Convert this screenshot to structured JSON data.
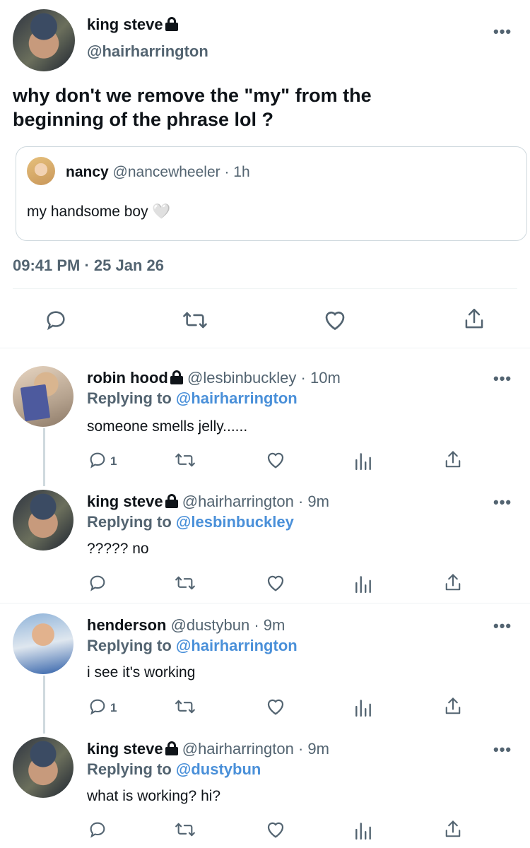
{
  "main_tweet": {
    "author_name": "king steve",
    "author_handle": "@hairharrington",
    "text_line1": "why don't we remove the \"my\" from the",
    "text_line2": "beginning of the phrase lol ?",
    "more": "•••",
    "timestamp": "09:41 PM · 25 Jan 26",
    "quoted": {
      "author_name": "nancy",
      "author_handle": "@nancewheeler",
      "time": "· 1h",
      "text": "my handsome boy 🤍"
    },
    "actions": [
      "reply-icon",
      "retweet-icon",
      "like-icon",
      "share-icon"
    ]
  },
  "replies": [
    {
      "name": "robin hood",
      "handle": "@lesbinbuckley",
      "time": "· 10m",
      "replying_prefix": "Replying to",
      "replying_to": "@hairharrington",
      "text": "someone smells jelly......",
      "reply_count": "1",
      "more": "•••"
    },
    {
      "name": "king steve",
      "handle": "@hairharrington",
      "time": "· 9m",
      "replying_prefix": "Replying to",
      "replying_to": "@lesbinbuckley",
      "text": "????? no",
      "reply_count": "",
      "more": "•••"
    },
    {
      "name": "henderson",
      "handle": "@dustybun",
      "time": "· 9m",
      "replying_prefix": "Replying to",
      "replying_to": "@hairharrington",
      "text": "i see it's working",
      "reply_count": "1",
      "more": "•••"
    },
    {
      "name": "king steve",
      "handle": "@hairharrington",
      "time": "· 9m",
      "replying_prefix": "Replying to",
      "replying_to": "@dustybun",
      "text": "what is working? hi?",
      "reply_count": "",
      "more": "•••"
    }
  ],
  "colors": {
    "text": "#0f1419",
    "secondary": "#536471",
    "mention": "#4a90d9",
    "border": "#cfd9de"
  }
}
